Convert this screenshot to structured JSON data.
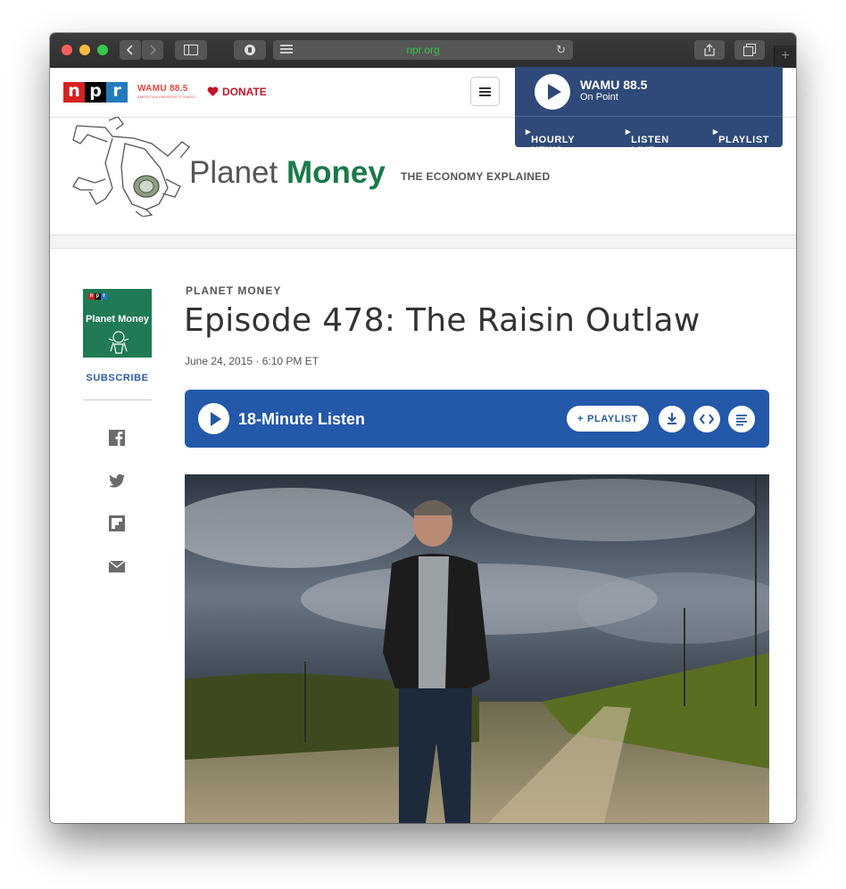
{
  "browser": {
    "url": "npr.org",
    "new_tab_icon": "plus-icon",
    "icons": [
      "back-icon",
      "forward-icon",
      "sidebar-icon",
      "privacy-icon",
      "reader-icon",
      "reload-icon",
      "share-icon",
      "tabs-icon"
    ]
  },
  "header": {
    "npr_letters": [
      "n",
      "p",
      "r"
    ],
    "npr_colors": [
      "#d62021",
      "#000000",
      "#237bbd"
    ],
    "station_logo": "WAMU 88.5",
    "station_logo_sub": "AMERICAN UNIVERSITY RADIO",
    "donate_label": "DONATE",
    "accent": "#c4152b"
  },
  "station": {
    "name": "WAMU 88.5",
    "show": "On Point",
    "links": [
      "HOURLY NEWS",
      "LISTEN LIVE",
      "PLAYLIST"
    ]
  },
  "program": {
    "name_light": "Planet",
    "name_bold": "Money",
    "tagline": "THE ECONOMY EXPLAINED",
    "brand_color": "#1a7a4a"
  },
  "sidebar": {
    "cover_title": "Planet Money",
    "subscribe_label": "SUBSCRIBE",
    "share_icons": [
      "facebook-icon",
      "twitter-icon",
      "flipboard-icon",
      "email-icon"
    ]
  },
  "article": {
    "eyebrow": "PLANET MONEY",
    "title": "Episode 478: The Raisin Outlaw",
    "date": "June 24, 2015 · 6:10 PM ET"
  },
  "player": {
    "length_label": "18-Minute Listen",
    "playlist_label": "PLAYLIST",
    "color": "#2458a8"
  }
}
